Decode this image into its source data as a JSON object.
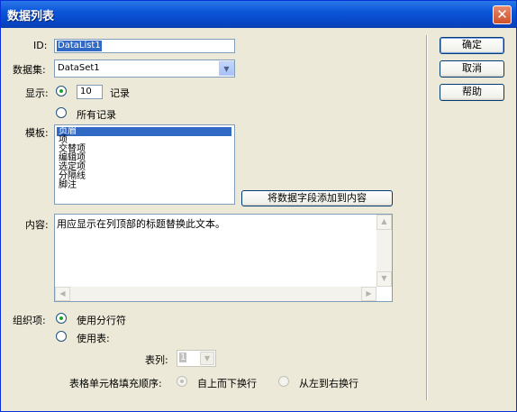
{
  "window": {
    "title": "数据列表",
    "close_glyph": "✕"
  },
  "form": {
    "id_label": "ID:",
    "id_value": "DataList1",
    "dataset_label": "数据集:",
    "dataset_value": "DataSet1",
    "show_label": "显示:",
    "show_count": "10",
    "records_label": "记录",
    "all_records_label": "所有记录",
    "template_label": "模板:",
    "templates": [
      "页眉",
      "项",
      "交替项",
      "编辑项",
      "选定项",
      "分隔线",
      "脚注"
    ],
    "add_field_button": "将数据字段添加到内容",
    "content_label": "内容:",
    "content_text": "用应显示在列顶部的标题替换此文本。",
    "organize_label": "组织项:",
    "use_line_break": "使用分行符",
    "use_table": "使用表:",
    "columns_label": "表列:",
    "columns_value": "1",
    "fill_order_label": "表格单元格填充顺序:",
    "top_to_bottom": "自上而下换行",
    "left_to_right": "从左到右换行"
  },
  "buttons": {
    "ok": "确定",
    "cancel": "取消",
    "help": "帮助"
  },
  "icons": {
    "dropdown": "chevron-down-icon",
    "close": "close-icon"
  }
}
